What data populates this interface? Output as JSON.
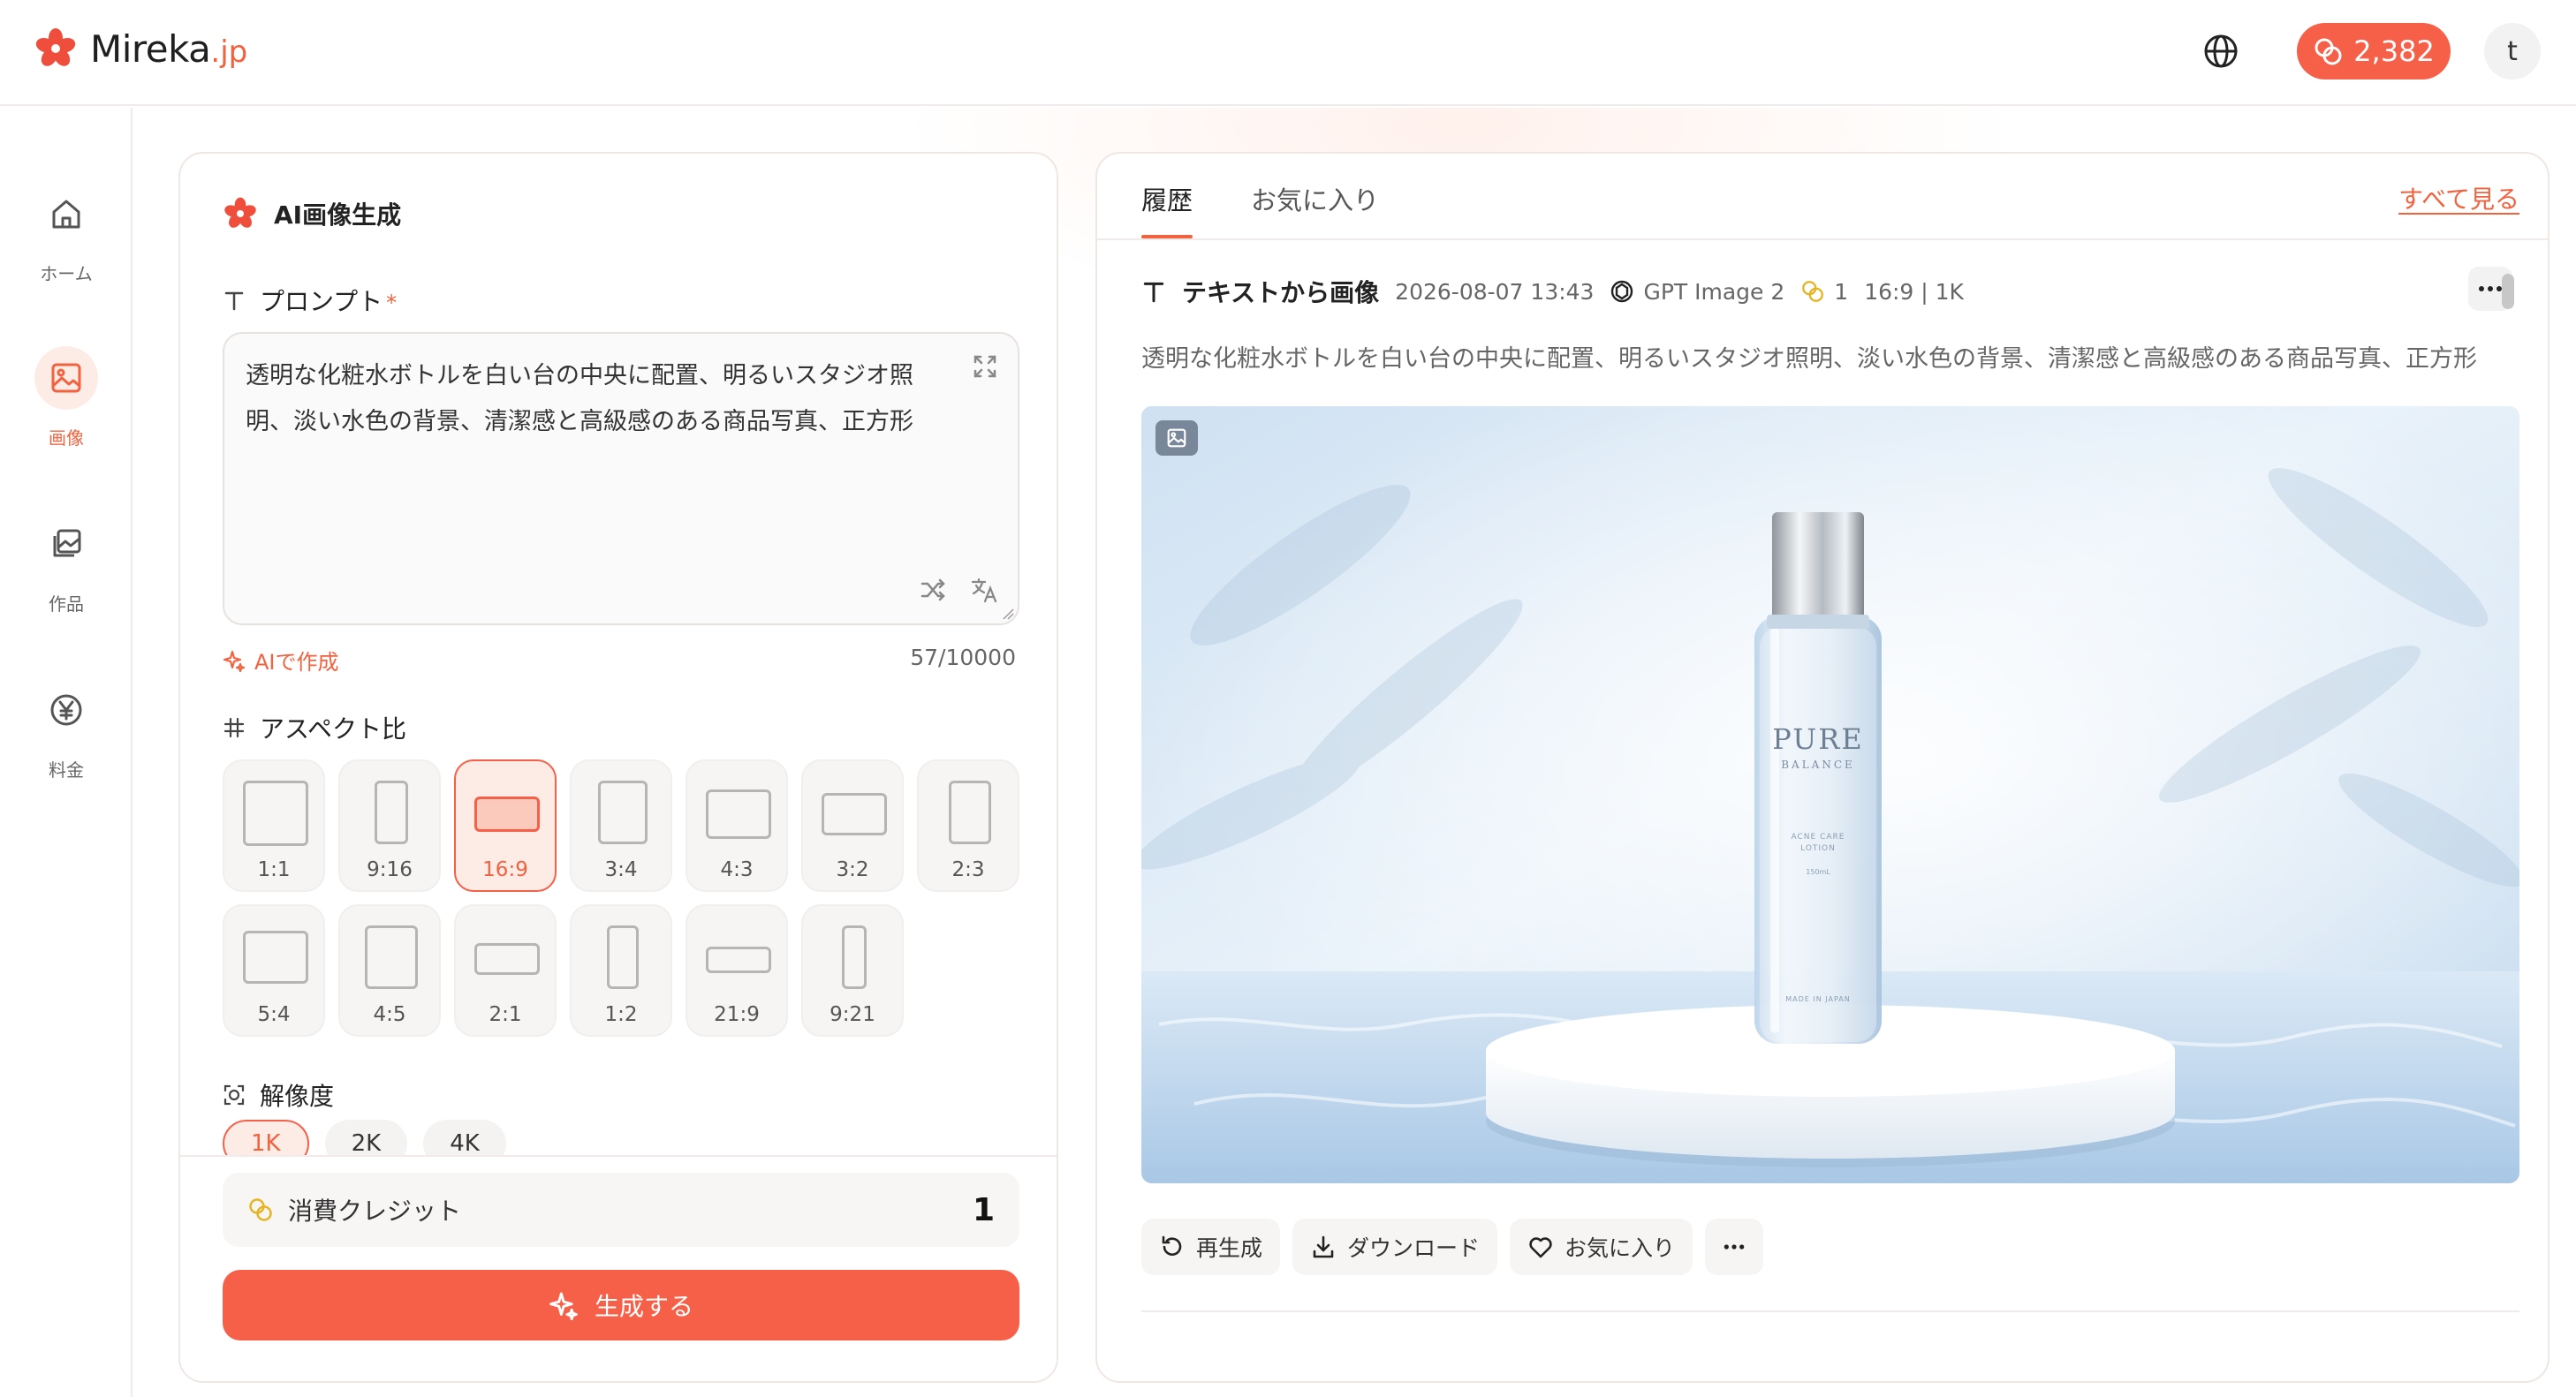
{
  "app": {
    "logo_text": "Mireka",
    "logo_tld": ".jp",
    "credits": "2,382",
    "avatar_initial": "t",
    "brand_color": "#f66048"
  },
  "sidebar": {
    "items": [
      {
        "label": "ホーム",
        "icon": "home-icon",
        "active": false
      },
      {
        "label": "画像",
        "icon": "image-icon",
        "active": true
      },
      {
        "label": "作品",
        "icon": "gallery-icon",
        "active": false
      },
      {
        "label": "料金",
        "icon": "yen-icon",
        "active": false
      }
    ]
  },
  "generator": {
    "title": "AI画像生成",
    "prompt_label": "プロンプト",
    "required_mark": "*",
    "prompt_text": "透明な化粧水ボトルを白い台の中央に配置、明るいスタジオ照明、淡い水色の背景、清潔感と高級感のある商品写真、正方形",
    "ai_create_label": "AIで作成",
    "char_count": "57/10000",
    "aspect_label": "アスペクト比",
    "aspect_ratios": [
      "1:1",
      "9:16",
      "16:9",
      "3:4",
      "4:3",
      "3:2",
      "2:3",
      "5:4",
      "4:5",
      "2:1",
      "1:2",
      "21:9",
      "9:21"
    ],
    "aspect_selected": "16:9",
    "resolution_label": "解像度",
    "resolutions": [
      "1K",
      "2K",
      "4K"
    ],
    "resolution_selected": "1K",
    "credit_label": "消費クレジット",
    "credit_value": "1",
    "generate_label": "生成する"
  },
  "history": {
    "tabs": [
      "履歴",
      "お気に入り"
    ],
    "active_tab": "履歴",
    "see_all": "すべて見る",
    "entry": {
      "type": "テキストから画像",
      "timestamp": "2026-08-07 13:43",
      "model": "GPT Image 2",
      "credits": "1",
      "spec": "16:9 | 1K",
      "prompt": "透明な化粧水ボトルを白い台の中央に配置、明るいスタジオ照明、淡い水色の背景、清潔感と高級感のある商品写真、正方形",
      "bottle_brand": "PURE",
      "bottle_sub": "BALANCE",
      "bottle_line1": "ACNE CARE",
      "bottle_line2": "LOTION",
      "bottle_volume": "150mL",
      "bottle_origin": "MADE IN JAPAN"
    },
    "actions": {
      "regenerate": "再生成",
      "download": "ダウンロード",
      "favorite": "お気に入り"
    }
  }
}
